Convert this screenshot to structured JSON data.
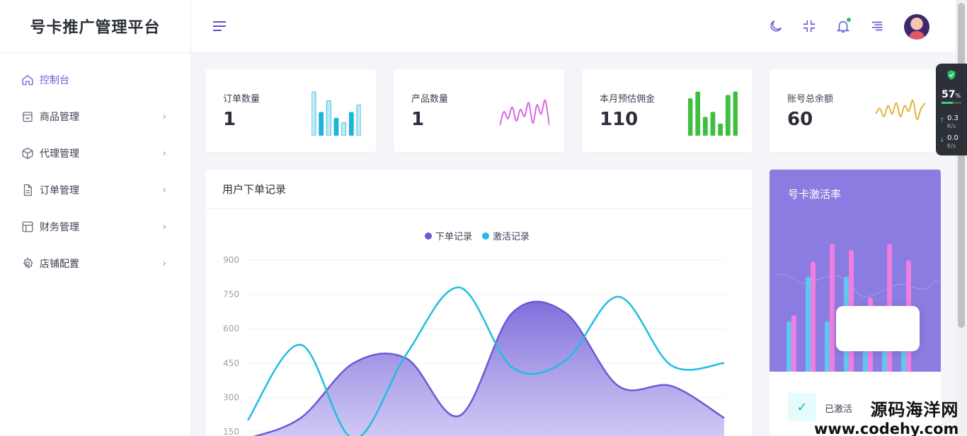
{
  "brand": {
    "title": "号卡推广管理平台"
  },
  "sidebar": {
    "items": [
      {
        "label": "控制台",
        "icon": "home-icon",
        "active": true
      },
      {
        "label": "商品管理",
        "icon": "shopping-bag-icon"
      },
      {
        "label": "代理管理",
        "icon": "cube-icon"
      },
      {
        "label": "订单管理",
        "icon": "document-icon"
      },
      {
        "label": "财务管理",
        "icon": "layout-icon"
      },
      {
        "label": "店铺配置",
        "icon": "gear-icon"
      }
    ],
    "chevron": "›"
  },
  "header": {
    "icons": [
      "menu-icon",
      "moon-icon",
      "compress-icon",
      "bell-icon",
      "align-right-icon"
    ],
    "notification_dot_color": "#24c26b"
  },
  "stats": [
    {
      "label": "订单数量",
      "value": "1",
      "color": "#1ab5d9",
      "spark": "bars",
      "spark_values": [
        30,
        16,
        24,
        12,
        9,
        16,
        21
      ]
    },
    {
      "label": "产品数量",
      "value": "1",
      "color": "#d66be0",
      "spark": "line",
      "spark_values": [
        2,
        8,
        5,
        10,
        4,
        9,
        6,
        12,
        3,
        11,
        7,
        13,
        2
      ]
    },
    {
      "label": "本月预估佣金",
      "value": "110",
      "color": "#3fbf3f",
      "spark": "bars",
      "spark_values": [
        22,
        26,
        11,
        14,
        7,
        24,
        26
      ]
    },
    {
      "label": "账号总余额",
      "value": "60",
      "color": "#e3b23c",
      "spark": "line",
      "spark_values": [
        6,
        8,
        5,
        9,
        6,
        10,
        5,
        9,
        7,
        11,
        4,
        8,
        10
      ]
    }
  ],
  "chart": {
    "title": "用户下单记录",
    "legend": [
      {
        "name": "下单记录",
        "color": "#6a5ad6"
      },
      {
        "name": "激活记录",
        "color": "#22bde0"
      }
    ]
  },
  "chart_data": {
    "type": "line",
    "ylim": [
      0,
      900
    ],
    "ytick_labels": [
      "900",
      "750",
      "600",
      "450",
      "300",
      "150"
    ],
    "yticks": [
      900,
      750,
      600,
      450,
      300,
      150
    ],
    "x": [
      0,
      1,
      2,
      3,
      4,
      5,
      6,
      7,
      8,
      9
    ],
    "series": [
      {
        "name": "下单记录",
        "area": true,
        "values": [
          120,
          210,
          450,
          470,
          220,
          670,
          670,
          350,
          350,
          210
        ]
      },
      {
        "name": "激活记录",
        "area": false,
        "values": [
          200,
          530,
          120,
          490,
          780,
          430,
          460,
          740,
          440,
          450
        ]
      }
    ]
  },
  "activation": {
    "title": "号卡激活率",
    "status_text": "已激活",
    "bars": [
      {
        "blue": 0.36,
        "pink": 0.4
      },
      {
        "blue": 0.66,
        "pink": 0.76
      },
      {
        "blue": 0.36,
        "pink": 0.88
      },
      {
        "blue": 0.66,
        "pink": 0.84
      },
      {
        "blue": 0.3,
        "pink": 0.52
      },
      {
        "blue": 0.2,
        "pink": 0.88
      },
      {
        "blue": 0.2,
        "pink": 0.77
      }
    ],
    "bar_colors": {
      "blue": "#5fc6f0",
      "pink": "#f07de0"
    }
  },
  "network_widget": {
    "percent": "57",
    "percent_unit": "%",
    "upload": "0.3",
    "download": "0.0",
    "unit": "K/s"
  },
  "watermark": {
    "cn": "源码海洋网",
    "url": "www.codehy.com"
  }
}
